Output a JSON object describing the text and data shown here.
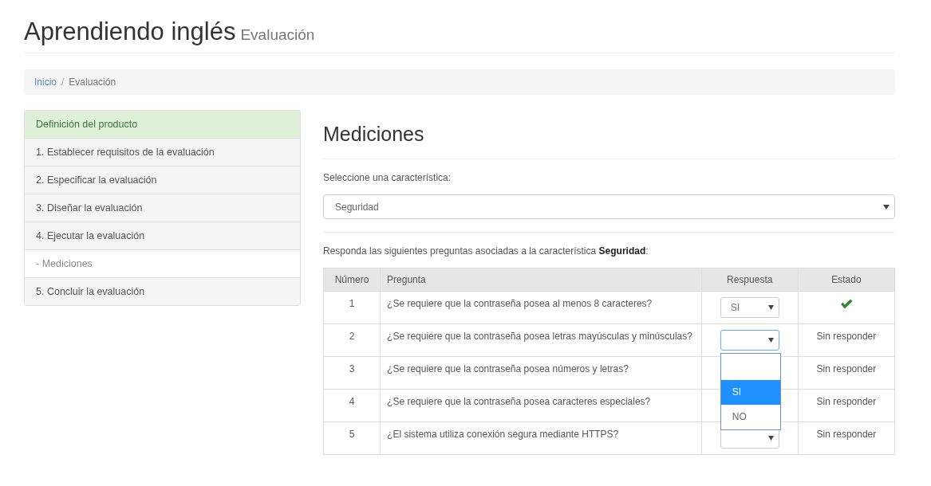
{
  "header": {
    "title": "Aprendiendo inglés",
    "subtitle": "Evaluación"
  },
  "breadcrumb": {
    "separator": "/",
    "items": [
      {
        "label": "Inicio",
        "link": true
      },
      {
        "label": "Evaluación",
        "link": false
      }
    ]
  },
  "sidebar": {
    "heading": "Definición del producto",
    "items": [
      {
        "label": "1. Establecer requisitos de la evaluación",
        "selected": false
      },
      {
        "label": "2. Especificar la evaluación",
        "selected": false
      },
      {
        "label": "3. Diseñar la evaluación",
        "selected": false
      },
      {
        "label": "4. Ejecutar la evaluación",
        "selected": false
      },
      {
        "label": "- Mediciones",
        "selected": true
      },
      {
        "label": "5. Concluir la evaluación",
        "selected": false
      }
    ]
  },
  "main": {
    "title": "Mediciones",
    "select_label": "Seleccione una característica:",
    "select_value": "Seguridad",
    "instructions": "Responda las siguientes preguntas asociadas a la característica **Seguridad**:",
    "table": {
      "columns": [
        "Número",
        "Pregunta",
        "Respuesta",
        "Estado"
      ],
      "rows": [
        {
          "number": "1",
          "question": "¿Se requiere que la contraseña posea al menos 8 caracteres?",
          "answer": "SI",
          "focused": false,
          "answered": true
        },
        {
          "number": "2",
          "question": "¿Se requiere que la contraseña posea letras mayúsculas y minúsculas?",
          "focused": true,
          "answered": false,
          "status": "Sin responder",
          "options": [
            {
              "label": "SI",
              "highlighted": true
            },
            {
              "label": "NO",
              "highlighted": false
            }
          ]
        },
        {
          "number": "3",
          "question": "¿Se requiere que la contraseña posea números y letras?",
          "answered": false,
          "status": "Sin responder"
        },
        {
          "number": "4",
          "question": "¿Se requiere que la contraseña posea caracteres especiales?",
          "answered": false,
          "status": "Sin responder"
        },
        {
          "number": "5",
          "question": "¿El sistema utiliza conexión segura mediante HTTPS?",
          "focused": false,
          "answered": false,
          "status": "Sin responder"
        }
      ]
    }
  }
}
